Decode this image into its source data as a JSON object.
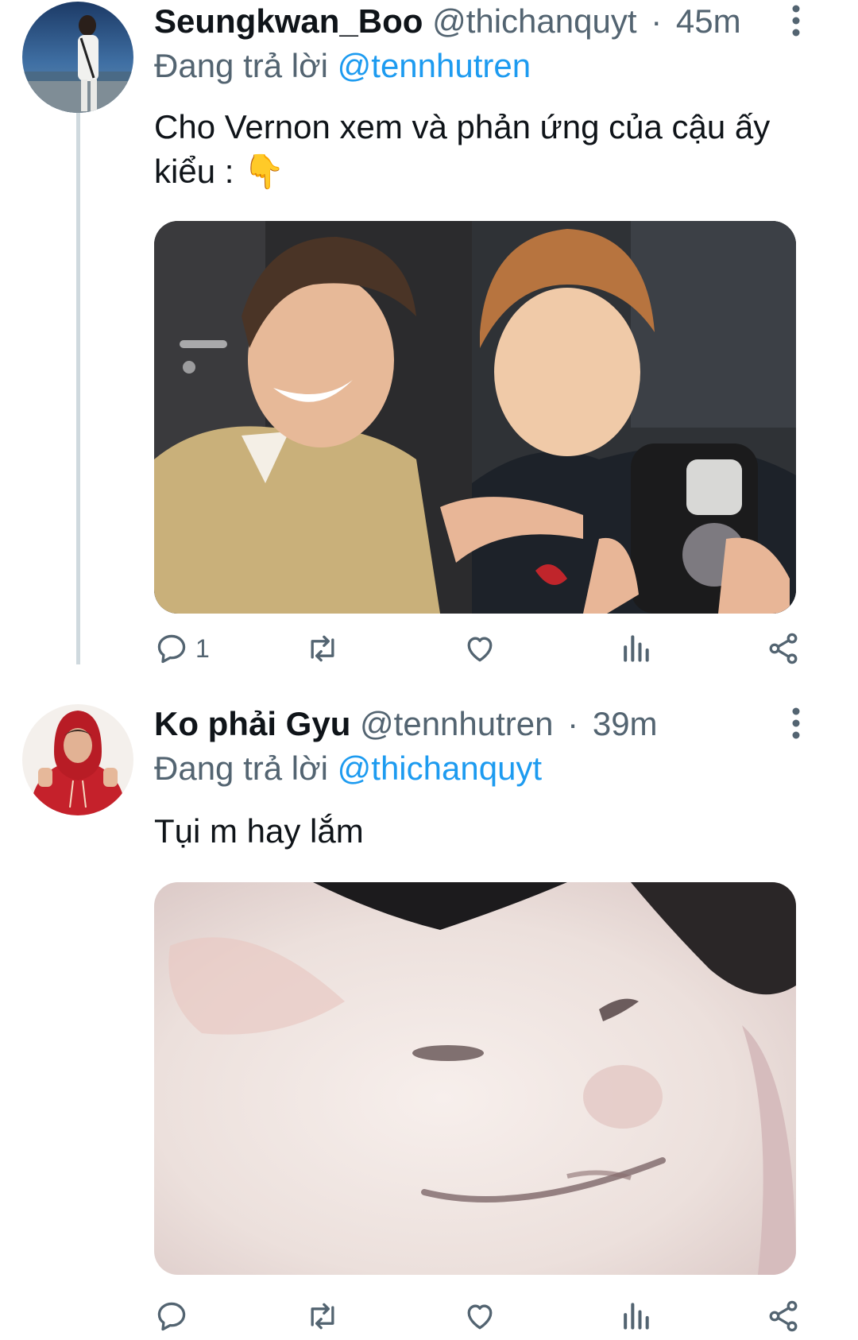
{
  "tweets": [
    {
      "display_name": "Seungkwan_Boo",
      "handle": "@thichanquyt",
      "separator": "·",
      "time": "45m",
      "reply_prefix": "Đang trả lời",
      "reply_to": "@tennhutren",
      "text": "Cho Vernon xem và phản ứng của cậu ấy kiểu : 👇",
      "actions": {
        "reply_count": "1",
        "retweet_count": "",
        "like_count": "",
        "views_count": ""
      }
    },
    {
      "display_name": "Ko phải Gyu",
      "handle": "@tennhutren",
      "separator": "·",
      "time": "39m",
      "reply_prefix": "Đang trả lời",
      "reply_to": "@thichanquyt",
      "text": "Tụi m hay lắm",
      "actions": {
        "reply_count": "",
        "retweet_count": "",
        "like_count": "",
        "views_count": ""
      }
    }
  ],
  "icons": {
    "more": "more-vertical-icon",
    "reply": "reply-icon",
    "retweet": "retweet-icon",
    "like": "heart-icon",
    "views": "views-icon",
    "share": "share-icon"
  },
  "colors": {
    "accent": "#1d9bf0",
    "muted": "#536471",
    "text": "#0f1419",
    "thread_line": "#cfd9de"
  }
}
